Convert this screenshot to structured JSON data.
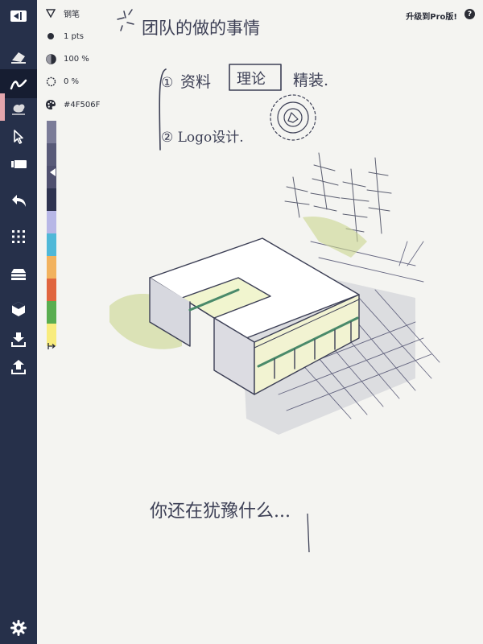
{
  "toolbar": {
    "items": [
      {
        "icon": "collapse-sidebar-icon"
      },
      {
        "icon": "eraser-tool-icon"
      },
      {
        "icon": "pen-tool-icon"
      },
      {
        "icon": "smudge-tool-icon"
      },
      {
        "icon": "select-tool-icon"
      },
      {
        "icon": "ruler-tool-icon"
      },
      {
        "icon": "undo-icon"
      },
      {
        "icon": "grid-icon"
      },
      {
        "icon": "layers-icon"
      },
      {
        "icon": "cube-icon"
      },
      {
        "icon": "import-icon"
      },
      {
        "icon": "export-icon"
      },
      {
        "icon": "settings-icon"
      }
    ],
    "active_tool": "pen-tool-icon"
  },
  "brush_options": {
    "brush_name": "钢笔",
    "size": "1 pts",
    "opacity": "100 %",
    "smoothing": "0 %",
    "color_hex": "#4F506F"
  },
  "palette": [
    "#7b7c98",
    "#585a78",
    "#4f506f",
    "#2e3350",
    "#b7b7e6",
    "#4fb8d8",
    "#f2b25e",
    "#e0653f",
    "#59ad50",
    "#f8ec7d"
  ],
  "header": {
    "upgrade_label": "升级到Pro版!",
    "help_label": "?"
  },
  "colors": {
    "sidebar": "#26304a",
    "canvas": "#f4f4f1",
    "ink": "#3c3f55"
  },
  "sketch": {
    "title": "团队的做的事情",
    "item1_prefix": "①",
    "item1_a": "资料",
    "item1_box": "理论",
    "item1_b": "精装.",
    "item2": "② Logo设计.",
    "bottom_note": "你还在犹豫什么..."
  }
}
